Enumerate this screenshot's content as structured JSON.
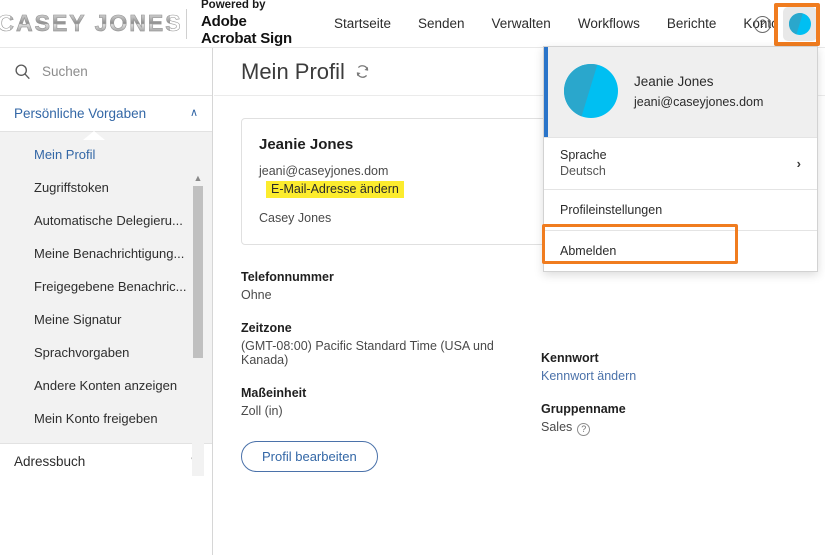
{
  "header": {
    "logo_text": "CASEY JONES",
    "powered_line1": "Powered by",
    "powered_line2": "Adobe",
    "powered_line3": "Acrobat Sign",
    "nav_items": [
      {
        "label": "Startseite"
      },
      {
        "label": "Senden"
      },
      {
        "label": "Verwalten"
      },
      {
        "label": "Workflows"
      },
      {
        "label": "Berichte"
      },
      {
        "label": "Konto"
      }
    ],
    "help_glyph": "?",
    "avatar_name": "avatar-icon"
  },
  "sidebar": {
    "search_placeholder": "Suchen",
    "groups": [
      {
        "label": "Persönliche Vorgaben",
        "chevron": "∧",
        "items": [
          {
            "label": "Mein Profil",
            "active": true
          },
          {
            "label": "Zugriffstoken",
            "active": false
          },
          {
            "label": "Automatische Delegieru...",
            "active": false
          },
          {
            "label": "Meine Benachrichtigung...",
            "active": false
          },
          {
            "label": "Freigegebene Benachric...",
            "active": false
          },
          {
            "label": "Meine Signatur",
            "active": false
          },
          {
            "label": "Sprachvorgaben",
            "active": false
          },
          {
            "label": "Andere Konten anzeigen",
            "active": false
          },
          {
            "label": "Mein Konto freigeben",
            "active": false
          }
        ]
      },
      {
        "label": "Adressbuch",
        "chevron": "∨",
        "items": []
      }
    ],
    "scroll_up_glyph": "▲"
  },
  "main": {
    "page_title": "Mein Profil",
    "refresh_icon": "refresh-icon",
    "profile_card": {
      "name": "Jeanie Jones",
      "email": "jeani@caseyjones.dom",
      "email_change_link": "E-Mail-Adresse ändern",
      "organization": "Casey Jones"
    },
    "fields_left": [
      {
        "label": "Telefonnummer",
        "value": "Ohne"
      },
      {
        "label": "Zeitzone",
        "value": "(GMT-08:00) Pacific Standard Time (USA und Kanada)"
      },
      {
        "label": "Maßeinheit",
        "value": "Zoll (in)"
      }
    ],
    "fields_right": [
      {
        "label": "Kennwort",
        "value": "Kennwort ändern",
        "is_link": true
      },
      {
        "label": "Gruppenname",
        "value": "Sales",
        "help": "?"
      }
    ],
    "edit_button": "Profil bearbeiten"
  },
  "user_menu": {
    "name": "Jeanie Jones",
    "email": "jeani@caseyjones.dom",
    "language_label": "Sprache",
    "language_value": "Deutsch",
    "language_chevron": "›",
    "profile_settings": "Profileinstellungen",
    "sign_out": "Abmelden"
  },
  "highlights": {
    "color": "#f07c1f",
    "avatar_box": "avatar-highlight",
    "profile_settings_box": "profileinstellungen-highlight"
  }
}
